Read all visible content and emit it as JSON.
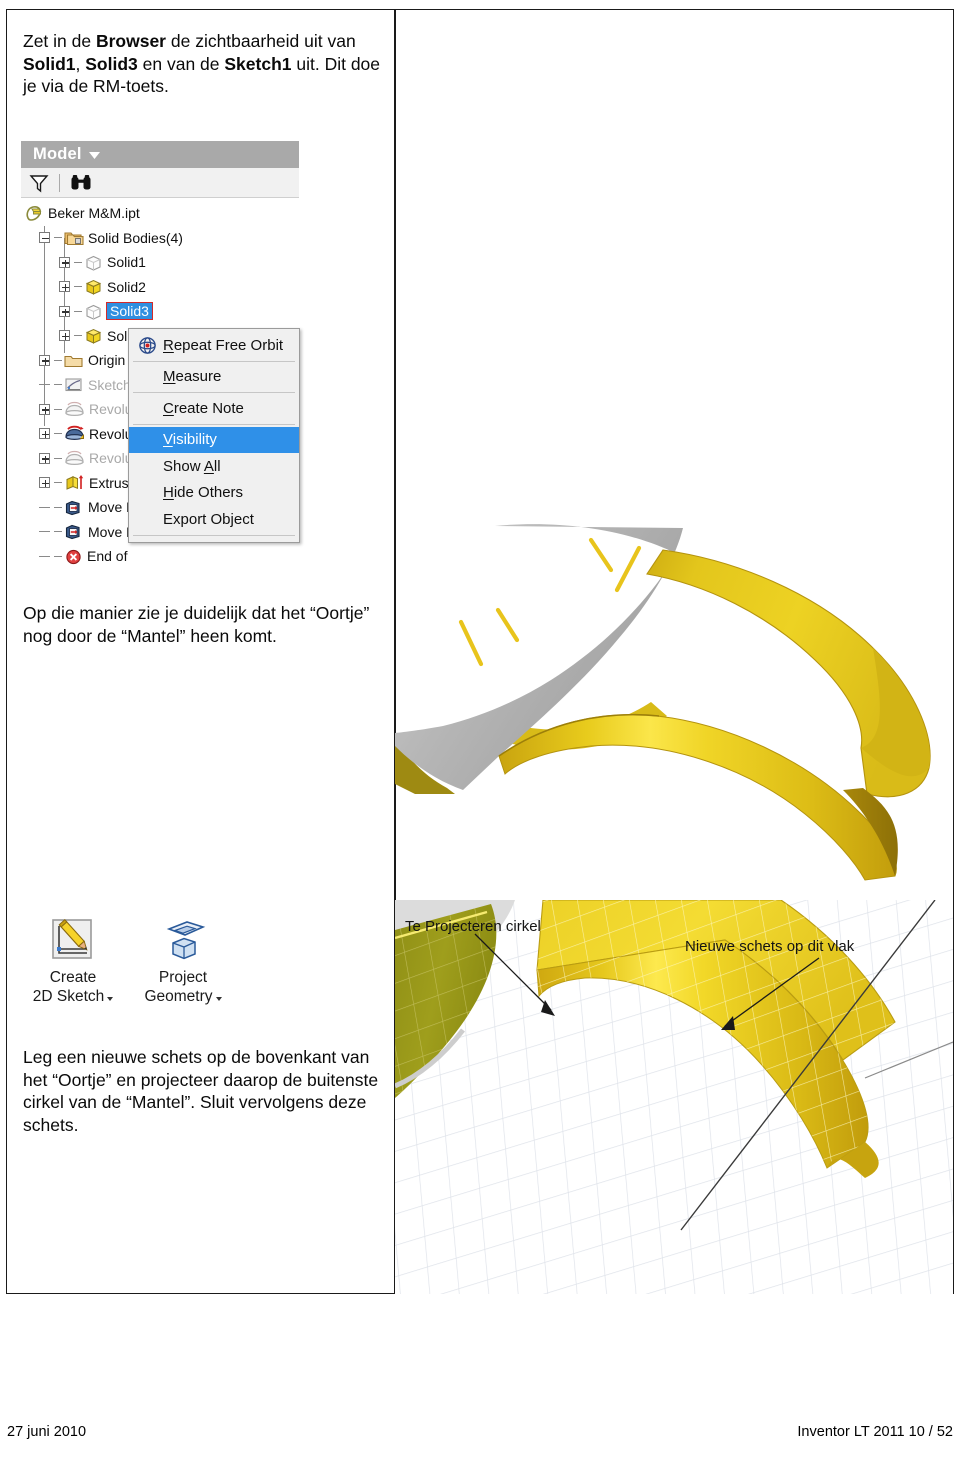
{
  "document": {
    "footer_left": "27 juni 2010",
    "footer_right": "Inventor LT 2011  10 / 52"
  },
  "instructions": {
    "intro": {
      "segments": [
        {
          "text": "Zet in de ",
          "bold": false
        },
        {
          "text": "Browser",
          "bold": true
        },
        {
          "text": " de zichtbaarheid uit van ",
          "bold": false
        },
        {
          "text": "Solid1",
          "bold": true
        },
        {
          "text": ", ",
          "bold": false
        },
        {
          "text": "Solid3",
          "bold": true
        },
        {
          "text": " en van de ",
          "bold": false
        },
        {
          "text": "Sketch1",
          "bold": true
        },
        {
          "text": " uit. Dit doe je via de RM-toets.",
          "bold": false
        }
      ]
    },
    "middle": {
      "segments": [
        {
          "text": "Op die manier zie je duidelijk dat het “Oortje” nog door de “Mantel” heen komt.",
          "bold": false
        }
      ]
    },
    "lower": {
      "segments": [
        {
          "text": "Leg een nieuwe schets op de bovenkant van het “Oortje” en projecteer daarop de buitenste cirkel van de “Mantel”. Sluit vervolgens deze schets.",
          "bold": false
        }
      ]
    }
  },
  "browser": {
    "title": "Model",
    "title_caret_icon": "chevron-down-icon",
    "toolbar": [
      {
        "icon": "filter-funnel-icon",
        "label": ""
      },
      {
        "icon": "binoculars-icon",
        "label": ""
      }
    ],
    "tree": [
      {
        "label": "Beker M&M.ipt",
        "icon": "part-document-icon",
        "indent": 0,
        "expander": "none",
        "dim": false,
        "selected": false
      },
      {
        "label": "Solid Bodies(4)",
        "icon": "folder-bodies-icon",
        "indent": 1,
        "expander": "minus",
        "dim": false,
        "selected": false
      },
      {
        "label": "Solid1",
        "icon": "solid-hidden-icon",
        "indent": 2,
        "expander": "plus",
        "dim": false,
        "selected": false
      },
      {
        "label": "Solid2",
        "icon": "solid-visible-icon",
        "indent": 2,
        "expander": "plus",
        "dim": false,
        "selected": false
      },
      {
        "label": "Solid3",
        "icon": "solid-hidden-icon",
        "indent": 2,
        "expander": "plus",
        "dim": false,
        "selected": true
      },
      {
        "label": "Sol",
        "icon": "solid-visible-icon",
        "indent": 2,
        "expander": "plus",
        "dim": false,
        "selected": false
      },
      {
        "label": "Origin",
        "icon": "origin-folder-icon",
        "indent": 1,
        "expander": "plus",
        "dim": false,
        "selected": false
      },
      {
        "label": "Sketch",
        "icon": "sketch-icon",
        "indent": 1,
        "expander": "none",
        "dim": true,
        "selected": false
      },
      {
        "label": "Revolu",
        "icon": "revolve-dim-icon",
        "indent": 1,
        "expander": "plus",
        "dim": true,
        "selected": false
      },
      {
        "label": "Revolu",
        "icon": "revolve-icon",
        "indent": 1,
        "expander": "plus",
        "dim": false,
        "selected": false
      },
      {
        "label": "Revolu",
        "icon": "revolve-dim-icon",
        "indent": 1,
        "expander": "plus",
        "dim": true,
        "selected": false
      },
      {
        "label": "Extrusi",
        "icon": "extrude-icon",
        "indent": 1,
        "expander": "plus",
        "dim": false,
        "selected": false
      },
      {
        "label": "Move F",
        "icon": "move-face-icon",
        "indent": 1,
        "expander": "none",
        "dim": false,
        "selected": false
      },
      {
        "label": "Move F",
        "icon": "move-face-icon",
        "indent": 1,
        "expander": "none",
        "dim": false,
        "selected": false
      },
      {
        "label": "End of",
        "icon": "end-of-part-icon",
        "indent": 1,
        "expander": "none",
        "dim": false,
        "selected": false
      }
    ]
  },
  "context_menu": {
    "items": [
      {
        "label": "Repeat Free Orbit",
        "accel": "R",
        "icon": "free-orbit-icon",
        "highlighted": false,
        "separator_after": true,
        "indent": false
      },
      {
        "label": "Measure",
        "accel": "M",
        "icon": "",
        "highlighted": false,
        "separator_after": true,
        "indent": true
      },
      {
        "label": "Create Note",
        "accel": "C",
        "icon": "",
        "highlighted": false,
        "separator_after": true,
        "indent": true
      },
      {
        "label": "Visibility",
        "accel": "V",
        "icon": "",
        "highlighted": true,
        "separator_after": false,
        "indent": true
      },
      {
        "label": "Show All",
        "accel": "A",
        "icon": "",
        "highlighted": false,
        "separator_after": false,
        "indent": true
      },
      {
        "label": "Hide Others",
        "accel": "H",
        "icon": "",
        "highlighted": false,
        "separator_after": false,
        "indent": true
      },
      {
        "label": "Export Object",
        "accel": "",
        "icon": "",
        "highlighted": false,
        "separator_after": true,
        "indent": true
      }
    ]
  },
  "ribbon": {
    "buttons": [
      {
        "line1": "Create",
        "line2": "2D Sketch",
        "icon": "create-2d-sketch-icon",
        "has_dropdown": true
      },
      {
        "line1": "Project",
        "line2": "Geometry",
        "icon": "project-geometry-icon",
        "has_dropdown": true
      }
    ]
  },
  "viewports": {
    "top": {
      "name": "shaded-model-view",
      "description": "Grey conical Mantel surface with yellow Oortje loop passing through it",
      "colors": {
        "mantel": "#b4b4b4",
        "oortje": "#e0c020",
        "highlight": "#f5d83a"
      }
    },
    "bottom": {
      "name": "sketch-mode-view",
      "description": "Sketch environment with grid, olive shaded surfaces and yellow Oortje",
      "colors": {
        "grid": "#d8dce4",
        "oortje": "#f0d02a",
        "mantel_olive": "#9a9a20"
      },
      "annotations": [
        {
          "text": "Te Projecteren cirkel",
          "name": "annotation-te-projecteren-cirkel"
        },
        {
          "text": "Nieuwe schets op dit vlak",
          "name": "annotation-nieuwe-schets-op-dit-vlak"
        }
      ]
    }
  }
}
